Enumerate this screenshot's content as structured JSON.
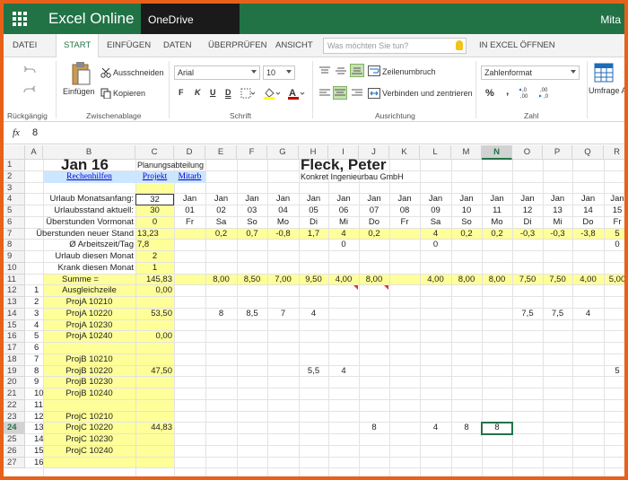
{
  "title_bar": {
    "app_name": "Excel Online",
    "service": "OneDrive",
    "account": "Mita"
  },
  "tabs": [
    "DATEI",
    "START",
    "EINFÜGEN",
    "DATEN",
    "ÜBERPRÜFEN",
    "ANSICHT"
  ],
  "active_tab": "START",
  "tell_me": {
    "placeholder": "Was möchten Sie tun?"
  },
  "open_in_excel": "IN EXCEL ÖFFNEN",
  "ribbon": {
    "undo_group": "Rückgängig",
    "clipboard": {
      "label": "Zwischenablage",
      "paste": "Einfügen",
      "cut": "Ausschneiden",
      "copy": "Kopieren"
    },
    "font": {
      "label": "Schrift",
      "name": "Arial",
      "size": "10",
      "bold": "F",
      "italic": "K",
      "underline": "U",
      "strike": "D"
    },
    "alignment": {
      "label": "Ausrichtung",
      "wrap": "Zeilenumbruch",
      "merge": "Verbinden und zentrieren"
    },
    "number": {
      "label": "Zahl",
      "format": "Zahlenformat",
      "percent": "%",
      "thousands": "‚",
      "inc_decimal": "←,0\n,00",
      "dec_decimal": ",00\n→,0"
    },
    "styles": {
      "format_table": "Umfrage A"
    }
  },
  "formula_bar": {
    "fx": "fx",
    "value": "8"
  },
  "columns": [
    "A",
    "B",
    "C",
    "D",
    "E",
    "F",
    "G",
    "H",
    "I",
    "J",
    "K",
    "L",
    "M",
    "N",
    "O",
    "P",
    "Q",
    "R"
  ],
  "selected_column": "N",
  "rows": [
    "1",
    "2",
    "3",
    "4",
    "5",
    "6",
    "7",
    "8",
    "9",
    "10",
    "11",
    "12",
    "13",
    "14",
    "15",
    "16",
    "17",
    "18",
    "19",
    "20",
    "21",
    "22",
    "23",
    "24",
    "25",
    "26",
    "27"
  ],
  "selected_row": "24",
  "sheet": {
    "title_month": "Jan 16",
    "planning": "Planungsabteilung",
    "employee": "Fleck, Peter",
    "company": "Konkret Ingenieurbau GmbH",
    "link_help": "Rechenhilfen",
    "link_project": "Projekt",
    "link_staff": "Mitarb",
    "labels": {
      "r4": "Urlaub Monatsanfang:",
      "r5": "Urlaubsstand aktuell:",
      "r6": "Überstunden Vormonat",
      "r7": "Überstunden neuer Stand",
      "r8": "Ø Arbeitszeit/Tag",
      "r9": "Urlaub diesen Monat",
      "r10": "Krank diesen Monat",
      "r11": "Summe ="
    },
    "c_values": {
      "r4": "32",
      "r5": "30",
      "r6": "0",
      "r7": "13,23",
      "r8": "7,8",
      "r9": "2",
      "r10": "1",
      "r11": "145,83",
      "r12": "0,00",
      "r14": "53,50",
      "r16": "0,00",
      "r19": "47,50",
      "r24": "44,83"
    },
    "month_row": [
      "Jan",
      "Jan",
      "Jan",
      "Jan",
      "Jan",
      "Jan",
      "Jan",
      "Jan",
      "Jan",
      "Jan",
      "Jan",
      "Jan",
      "Jan",
      "Jan",
      "Jan"
    ],
    "day_row": [
      "01",
      "02",
      "03",
      "04",
      "05",
      "06",
      "07",
      "08",
      "09",
      "10",
      "11",
      "12",
      "13",
      "14",
      "15"
    ],
    "weekday_row": [
      "Fr",
      "Sa",
      "So",
      "Mo",
      "Di",
      "Mi",
      "Do",
      "Fr",
      "Sa",
      "So",
      "Mo",
      "Di",
      "Mi",
      "Do",
      "Fr"
    ],
    "r7_days": [
      "",
      "0,2",
      "0,7",
      "-0,8",
      "1,7",
      "4",
      "0,2",
      "",
      "4",
      "0,2",
      "0,2",
      "-0,3",
      "-0,3",
      "-3,8",
      "5"
    ],
    "r8_days": [
      "",
      "",
      "",
      "",
      "",
      "0",
      "",
      "",
      "0",
      "",
      "",
      "",
      "",
      "",
      "0"
    ],
    "r11_days": [
      "",
      "8,00",
      "8,50",
      "7,00",
      "9,50",
      "4,00",
      "8,00",
      "",
      "4,00",
      "8,00",
      "8,00",
      "7,50",
      "7,50",
      "4,00",
      "5,00"
    ],
    "r14_days": [
      "",
      "8",
      "8,5",
      "7",
      "4",
      "",
      "",
      "",
      "",
      "",
      "",
      "7,5",
      "7,5",
      "4",
      ""
    ],
    "r19_days": [
      "",
      "",
      "",
      "",
      "5,5",
      "4",
      "",
      "",
      "",
      "",
      "",
      "",
      "",
      "",
      "5"
    ],
    "r24_days": [
      "",
      "",
      "",
      "",
      "",
      "",
      "8",
      "",
      "4",
      "8",
      "8",
      "",
      "",
      "",
      ""
    ],
    "projects": [
      {
        "row": "r12",
        "nr": "1",
        "name": "Ausgleichzeile"
      },
      {
        "row": "r13",
        "nr": "2",
        "name": "ProjA 10210"
      },
      {
        "row": "r14",
        "nr": "3",
        "name": "ProjA 10220"
      },
      {
        "row": "r15",
        "nr": "4",
        "name": "ProjA 10230"
      },
      {
        "row": "r16",
        "nr": "5",
        "name": "ProjA 10240"
      },
      {
        "row": "r17",
        "nr": "6",
        "name": ""
      },
      {
        "row": "r18",
        "nr": "7",
        "name": "ProjB 10210"
      },
      {
        "row": "r19",
        "nr": "8",
        "name": "ProjB 10220"
      },
      {
        "row": "r20",
        "nr": "9",
        "name": "ProjB 10230"
      },
      {
        "row": "r21",
        "nr": "10",
        "name": "ProjB 10240"
      },
      {
        "row": "r22",
        "nr": "11",
        "name": ""
      },
      {
        "row": "r23",
        "nr": "12",
        "name": "ProjC 10210"
      },
      {
        "row": "r24",
        "nr": "13",
        "name": "ProjC 10220"
      },
      {
        "row": "r25",
        "nr": "14",
        "name": "ProjC 10230"
      },
      {
        "row": "r26",
        "nr": "15",
        "name": "ProjC 10240"
      },
      {
        "row": "r27",
        "nr": "16",
        "name": ""
      }
    ]
  },
  "colors": {
    "brand": "#217346",
    "frame": "#e8611a",
    "highlight": "#ffff99",
    "link": "#0000cc",
    "link_bg": "#cce6ff"
  }
}
